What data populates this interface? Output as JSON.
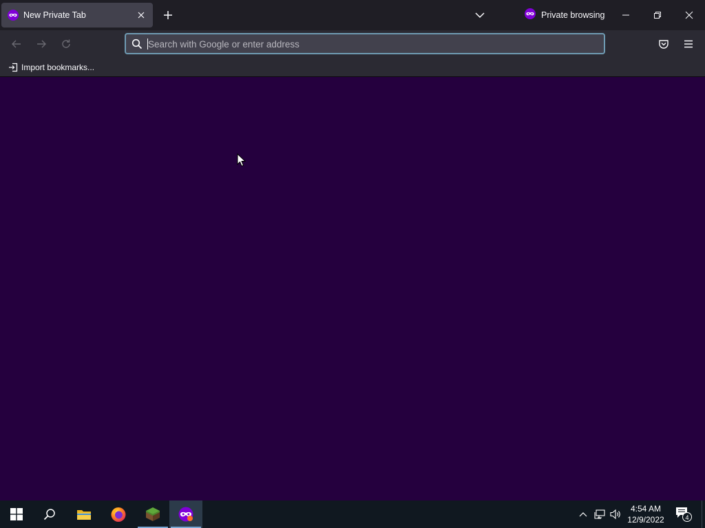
{
  "browser": {
    "tab": {
      "title": "New Private Tab",
      "icon": "private-mask-icon"
    },
    "private_label": "Private browsing",
    "urlbar": {
      "placeholder": "Search with Google or enter address",
      "value": ""
    },
    "bookmarks": {
      "import_label": "Import bookmarks..."
    },
    "colors": {
      "content_bg": "#25003e",
      "private_icon": "#8000d7",
      "urlbar_focus": "#6f9bb3"
    }
  },
  "taskbar": {
    "apps": [
      "windows-start",
      "search",
      "file-explorer",
      "firefox",
      "minecraft",
      "firefox-private"
    ],
    "time": "4:54 AM",
    "date": "12/9/2022",
    "notification_count": "4"
  }
}
